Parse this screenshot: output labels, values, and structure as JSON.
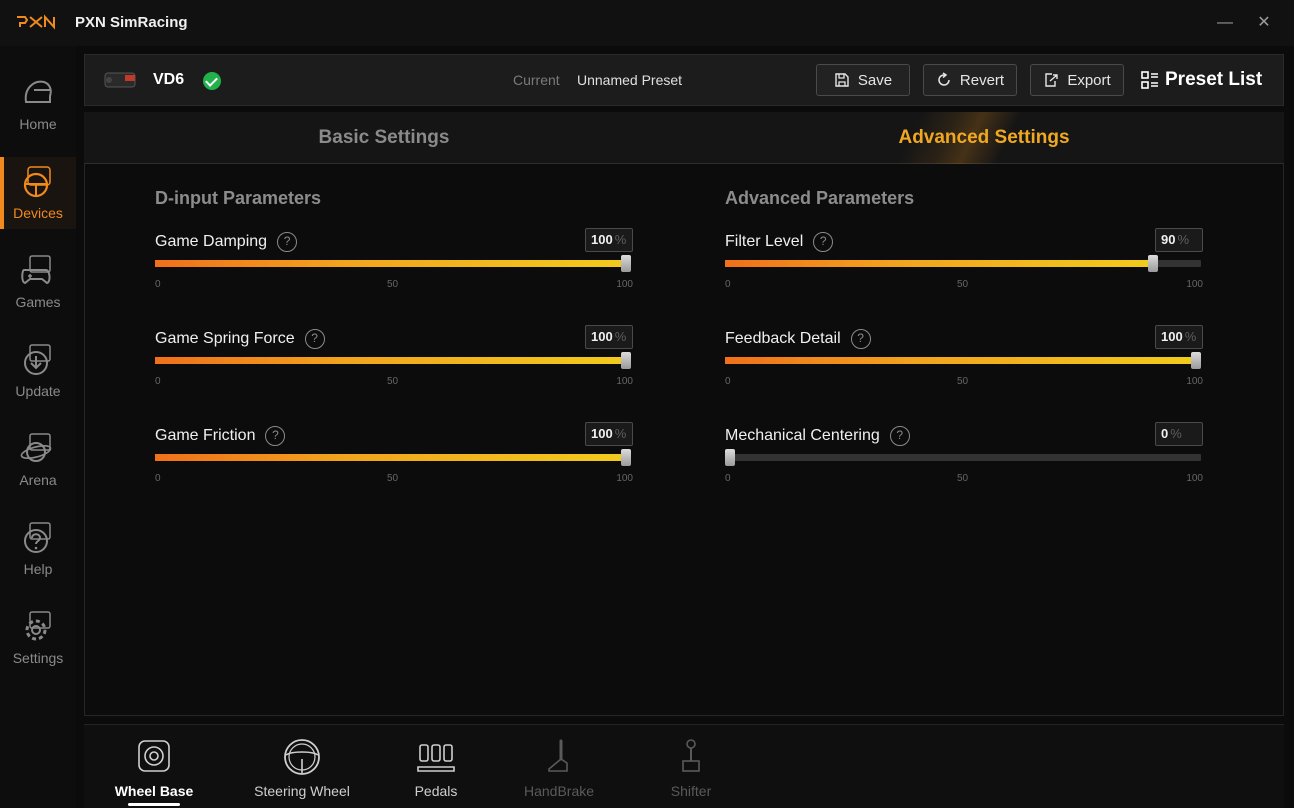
{
  "app": {
    "title": "PXN SimRacing",
    "logo": "PXN"
  },
  "window": {
    "minimize": "—",
    "close": "✕"
  },
  "sidebar": {
    "items": [
      {
        "label": "Home",
        "icon": "helmet-icon",
        "active": false
      },
      {
        "label": "Devices",
        "icon": "steering-wheel-icon",
        "active": true
      },
      {
        "label": "Games",
        "icon": "gamepad-icon",
        "active": false
      },
      {
        "label": "Update",
        "icon": "download-icon",
        "active": false
      },
      {
        "label": "Arena",
        "icon": "planet-icon",
        "active": false
      },
      {
        "label": "Help",
        "icon": "help-icon",
        "active": false
      },
      {
        "label": "Settings",
        "icon": "gear-icon",
        "active": false
      }
    ]
  },
  "device": {
    "name": "VD6",
    "status_icon": "check-circle-icon",
    "current_label": "Current",
    "current_preset": "Unnamed Preset"
  },
  "toolbar": {
    "save_label": "Save",
    "revert_label": "Revert",
    "export_label": "Export",
    "preset_list_label": "Preset List"
  },
  "tabs": {
    "basic": "Basic Settings",
    "advanced": "Advanced Settings",
    "active": "advanced"
  },
  "colors": {
    "accent": "#f08a1c",
    "tab_active": "#f0a822",
    "ok": "#22b24c"
  },
  "left_section": {
    "title": "D-input Parameters",
    "params": [
      {
        "label": "Game Damping",
        "value": "100",
        "unit": "%",
        "level": 100,
        "min": "0",
        "mid": "50",
        "max": "100"
      },
      {
        "label": "Game Spring Force",
        "value": "100",
        "unit": "%",
        "level": 100,
        "min": "0",
        "mid": "50",
        "max": "100"
      },
      {
        "label": "Game Friction",
        "value": "100",
        "unit": "%",
        "level": 100,
        "min": "0",
        "mid": "50",
        "max": "100"
      }
    ]
  },
  "right_section": {
    "title": "Advanced Parameters",
    "params": [
      {
        "label": "Filter Level",
        "value": "90",
        "unit": "%",
        "level": 90,
        "min": "0",
        "mid": "50",
        "max": "100"
      },
      {
        "label": "Feedback Detail",
        "value": "100",
        "unit": "%",
        "level": 100,
        "min": "0",
        "mid": "50",
        "max": "100"
      },
      {
        "label": "Mechanical Centering",
        "value": "0",
        "unit": "%",
        "level": 0,
        "min": "0",
        "mid": "50",
        "max": "100"
      }
    ]
  },
  "bottom_tabs": [
    {
      "label": "Wheel Base",
      "icon": "wheel-base-icon",
      "active": true,
      "disabled": false
    },
    {
      "label": "Steering Wheel",
      "icon": "steering-wheel-icon",
      "active": false,
      "disabled": false
    },
    {
      "label": "Pedals",
      "icon": "pedals-icon",
      "active": false,
      "disabled": false
    },
    {
      "label": "HandBrake",
      "icon": "handbrake-icon",
      "active": false,
      "disabled": true
    },
    {
      "label": "Shifter",
      "icon": "shifter-icon",
      "active": false,
      "disabled": true
    }
  ]
}
